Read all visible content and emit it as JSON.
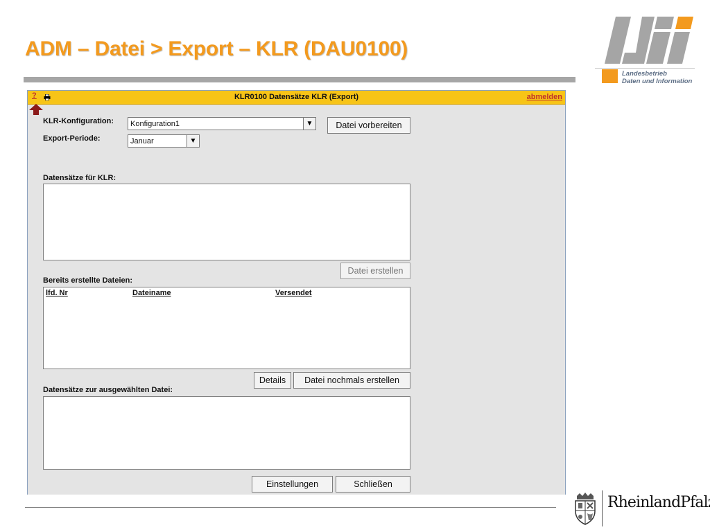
{
  "slide": {
    "title": "ADM – Datei > Export – KLR (DAU0100)"
  },
  "logo": {
    "mark": "ldi",
    "line1": "Landesbetrieb",
    "line2": "Daten und Information"
  },
  "app": {
    "header": {
      "help": "?",
      "print_icon": "printer-icon",
      "title": "KLR0100 Datensätze KLR (Export)",
      "logout": "abmelden"
    },
    "klr_config": {
      "label": "KLR-Konfiguration:",
      "value": "Konfiguration1"
    },
    "export_period": {
      "label": "Export-Periode:",
      "value": "Januar"
    },
    "buttons": {
      "prepare": "Datei vorbereiten",
      "create": "Datei erstellen",
      "details": "Details",
      "recreate": "Datei nochmals erstellen",
      "settings": "Einstellungen",
      "close": "Schließen"
    },
    "records_label": "Datensätze für KLR:",
    "files_label": "Bereits erstellte Dateien:",
    "files_columns": [
      "lfd. Nr",
      "Dateiname",
      "Versendet"
    ],
    "selected_label": "Datensätze zur ausgewählten Datei:"
  },
  "footer": {
    "brand": "RheinlandPfalz",
    "crest_icon": "coat-of-arms-icon"
  },
  "colors": {
    "title_orange": "#f39a1e",
    "header_yellow": "#f7c417",
    "link_red": "#c0322b",
    "ldi_gray": "#a5a5a5",
    "window_gray": "#e4e4e4"
  }
}
